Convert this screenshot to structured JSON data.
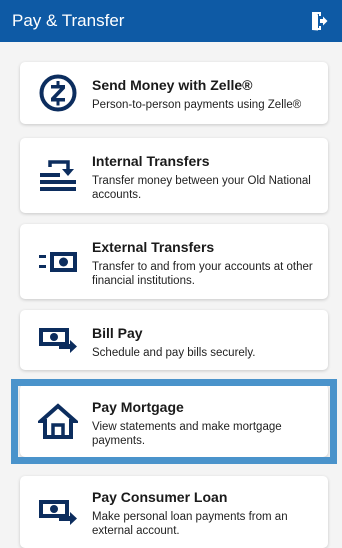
{
  "header": {
    "title": "Pay & Transfer",
    "exit_icon": "exit-icon"
  },
  "colors": {
    "header_bg": "#0e5aa5",
    "icon_navy": "#0c2d5e",
    "highlight": "#4a93cb"
  },
  "cards": [
    {
      "icon": "zelle-icon",
      "title": "Send Money with Zelle®",
      "description": "Person-to-person payments using Zelle®"
    },
    {
      "icon": "internal-transfer-icon",
      "title": "Internal Transfers",
      "description": "Transfer money between your Old National accounts."
    },
    {
      "icon": "external-transfer-icon",
      "title": "External Transfers",
      "description": "Transfer to and from your accounts at other financial institutions."
    },
    {
      "icon": "bill-pay-icon",
      "title": "Bill Pay",
      "description": "Schedule and pay bills securely."
    },
    {
      "icon": "home-icon",
      "title": "Pay Mortgage",
      "description": "View statements and make mortgage payments.",
      "selected": true
    },
    {
      "icon": "loan-payment-icon",
      "title": "Pay Consumer Loan",
      "description": "Make personal loan payments from an external account."
    }
  ]
}
